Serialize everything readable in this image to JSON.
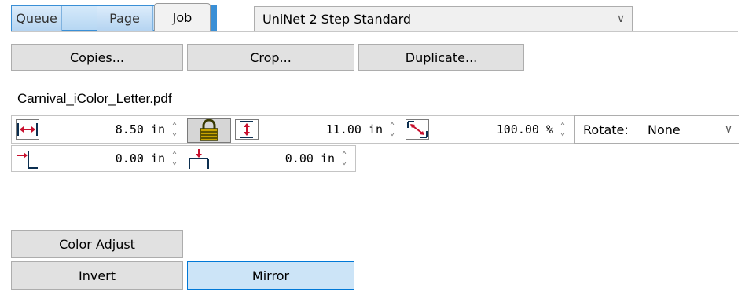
{
  "tabs": [
    {
      "label": "Queue"
    },
    {
      "label": "Page"
    },
    {
      "label": "Job"
    }
  ],
  "preset": {
    "value": "UniNet 2 Step Standard"
  },
  "buttons": {
    "copies": "Copies...",
    "crop": "Crop...",
    "duplicate": "Duplicate...",
    "color_adjust": "Color Adjust",
    "invert": "Invert",
    "mirror": "Mirror"
  },
  "file": {
    "name": "Carnival_iColor_Letter.pdf"
  },
  "dimensions": {
    "width": "8.50 in",
    "height": "11.00 in",
    "scale": "100.00 %",
    "offset_x": "0.00 in",
    "offset_y": "0.00 in"
  },
  "rotate": {
    "label": "Rotate:",
    "value": "None"
  },
  "states": {
    "mirror_pressed": true
  },
  "colors": {
    "tab_blue": "#3a8fd6",
    "pressed_blue": "#cce4f7",
    "icon_red": "#c8102e",
    "icon_dark": "#0c2f50"
  }
}
